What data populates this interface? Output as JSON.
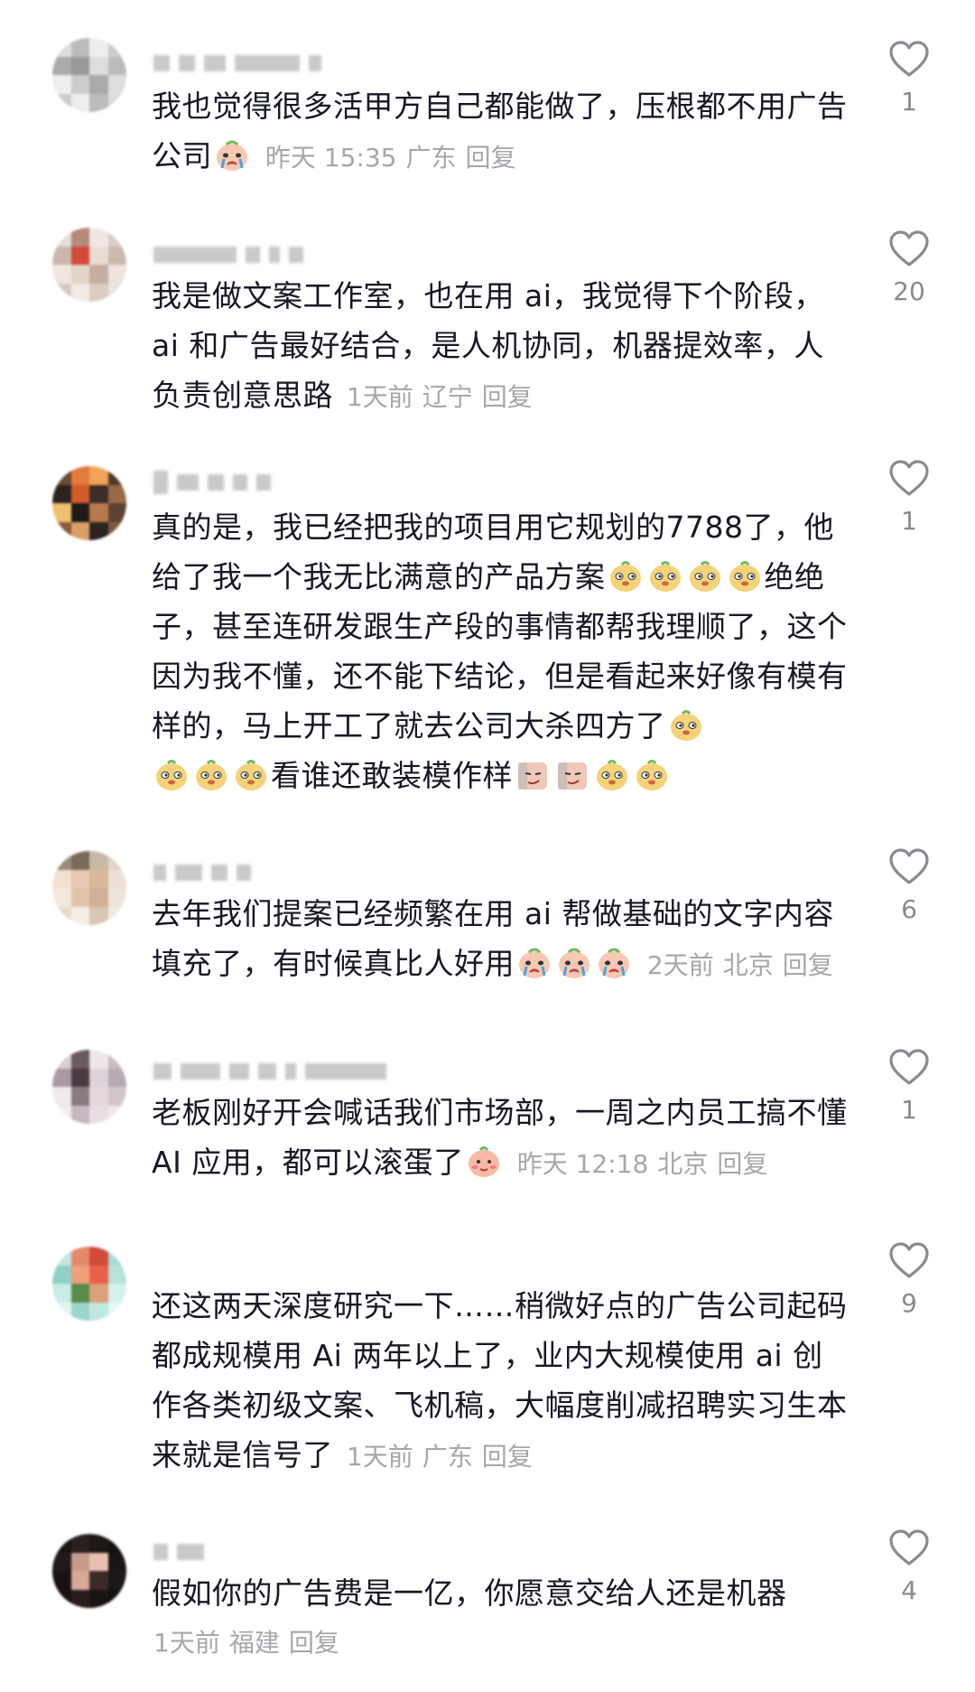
{
  "comments": [
    {
      "text_before": "我也觉得很多活甲方自己都能做了，压根都不用广告公司",
      "emojis_after": [
        "cry"
      ],
      "text_after": "",
      "emojis_end": [],
      "time": "昨天 15:35",
      "location": "广东",
      "reply": "回复",
      "likes": "1"
    },
    {
      "text_before": "我是做文案工作室，也在用 ai，我觉得下个阶段，ai 和广告最好结合，是人机协同，机器提效率，人负责创意思路",
      "emojis_after": [],
      "text_after": "",
      "emojis_end": [],
      "time": "1天前",
      "location": "辽宁",
      "reply": "回复",
      "likes": "20"
    },
    {
      "text_before": "真的是，我已经把我的项目用它规划的7788了，他给了我一个我无比满意的产品方案",
      "emojis_after": [
        "doge",
        "doge",
        "doge",
        "doge"
      ],
      "text_mid": "绝绝子，甚至连研发跟生产段的事情都帮我理顺了，这个因为我不懂，还不能下结论，但是看起来好像有模有样的，马上开工了就去公司大杀四方了",
      "emojis_mid": [
        "doge",
        "doge",
        "doge",
        "doge"
      ],
      "text_after": "看谁还敢装模作样",
      "emojis_end": [
        "smirk",
        "smirk",
        "doge",
        "doge"
      ],
      "time": "",
      "location": "",
      "reply": "",
      "likes": "1"
    },
    {
      "text_before": "去年我们提案已经频繁在用 ai 帮做基础的文字内容填充了，有时候真比人好用",
      "emojis_after": [
        "cry",
        "cry",
        "cry"
      ],
      "text_after": "",
      "emojis_end": [],
      "time": "2天前",
      "location": "北京",
      "reply": "回复",
      "likes": "6"
    },
    {
      "text_before": "老板刚好开会喊话我们市场部，一周之内员工搞不懂 AI 应用，都可以滚蛋了",
      "emojis_after": [
        "blush"
      ],
      "text_after": "",
      "emojis_end": [],
      "time": "昨天 12:18",
      "location": "北京",
      "reply": "回复",
      "likes": "1"
    },
    {
      "text_before": "还这两天深度研究一下……稍微好点的广告公司起码都成规模用 Ai 两年以上了，业内大规模使用 ai 创作各类初级文案、飞机稿，大幅度削减招聘实习生本来就是信号了",
      "emojis_after": [],
      "text_after": "",
      "emojis_end": [],
      "time": "1天前",
      "location": "广东",
      "reply": "回复",
      "likes": "9"
    },
    {
      "text_before": "假如你的广告费是一亿，你愿意交给人还是机器",
      "emojis_after": [],
      "text_after": "",
      "emojis_end": [],
      "time": "1天前",
      "location": "福建",
      "reply": "回复",
      "likes": "4"
    }
  ],
  "colors": {
    "text": "#161823",
    "meta": "#a6a7ab",
    "count": "#8a8b90",
    "heart": "#8a8b90"
  },
  "icons": {
    "like": "heart-outline-icon",
    "emoji_cry": "crying-face-emoji",
    "emoji_doge": "dog-face-emoji",
    "emoji_smirk": "smirking-face-emoji",
    "emoji_blush": "blushing-face-emoji"
  }
}
